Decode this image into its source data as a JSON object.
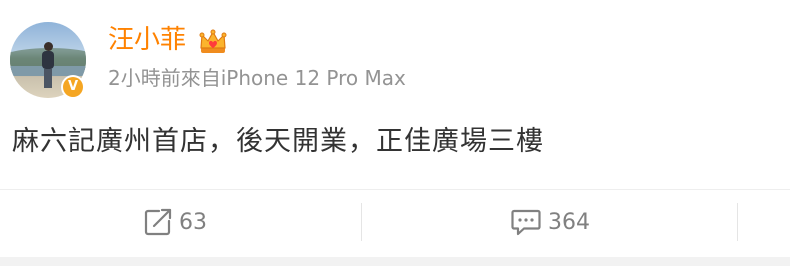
{
  "post": {
    "username": "汪小菲",
    "meta": "2小時前來自iPhone 12 Pro Max",
    "text": "麻六記廣州首店，後天開業，正佳廣場三樓",
    "verified_badge": "V"
  },
  "actions": {
    "repost_count": "63",
    "comment_count": "364"
  },
  "colors": {
    "username": "#ff8200",
    "meta": "#939393",
    "text": "#333333",
    "action": "#808080",
    "badge": "#f5a623"
  },
  "icons": {
    "repost": "repost-icon",
    "comment": "comment-icon",
    "crown": "crown-icon",
    "verified": "verified-icon"
  }
}
